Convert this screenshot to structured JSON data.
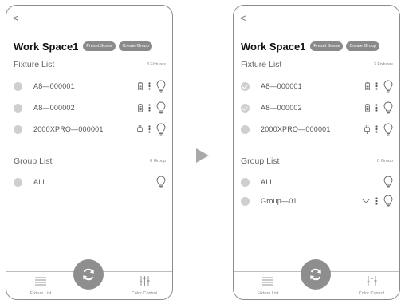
{
  "colors": {
    "accent": "#8e8e8e",
    "dot": "#cfcfcf",
    "pill": "#8a8a8a",
    "arrow": "#a9a9a9"
  },
  "screens": [
    {
      "back_icon": "chevron-left-icon",
      "workspace_title": "Work Space1",
      "preset_scene_label": "Preset Scene",
      "create_group_label": "Create Group",
      "fixture_list_title": "Fixture List",
      "fixture_count": "3 Fixtures",
      "fixtures": [
        {
          "name": "A8—000001",
          "checked": false,
          "power_icon": "battery-icon"
        },
        {
          "name": "A8—000002",
          "checked": false,
          "power_icon": "battery-icon"
        },
        {
          "name": "2000XPRO—000001",
          "checked": false,
          "power_icon": "plug-icon"
        }
      ],
      "group_list_title": "Group List",
      "group_count": "0 Group",
      "groups": [
        {
          "name": "ALL"
        }
      ],
      "tabs": {
        "fixture_list": "Fixture List",
        "color_control": "Color Control"
      }
    },
    {
      "back_icon": "chevron-left-icon",
      "workspace_title": "Work Space1",
      "preset_scene_label": "Preset Scene",
      "create_group_label": "Create Group",
      "fixture_list_title": "Fixture List",
      "fixture_count": "3 Fixtures",
      "fixtures": [
        {
          "name": "A8—000001",
          "checked": true,
          "power_icon": "battery-icon"
        },
        {
          "name": "A8—000002",
          "checked": true,
          "power_icon": "battery-icon"
        },
        {
          "name": "2000XPRO—000001",
          "checked": false,
          "power_icon": "plug-icon"
        }
      ],
      "group_list_title": "Group List",
      "group_count": "0 Group",
      "groups": [
        {
          "name": "ALL"
        },
        {
          "name": "Group—01"
        }
      ],
      "tabs": {
        "fixture_list": "Fixture List",
        "color_control": "Color Control"
      }
    }
  ]
}
